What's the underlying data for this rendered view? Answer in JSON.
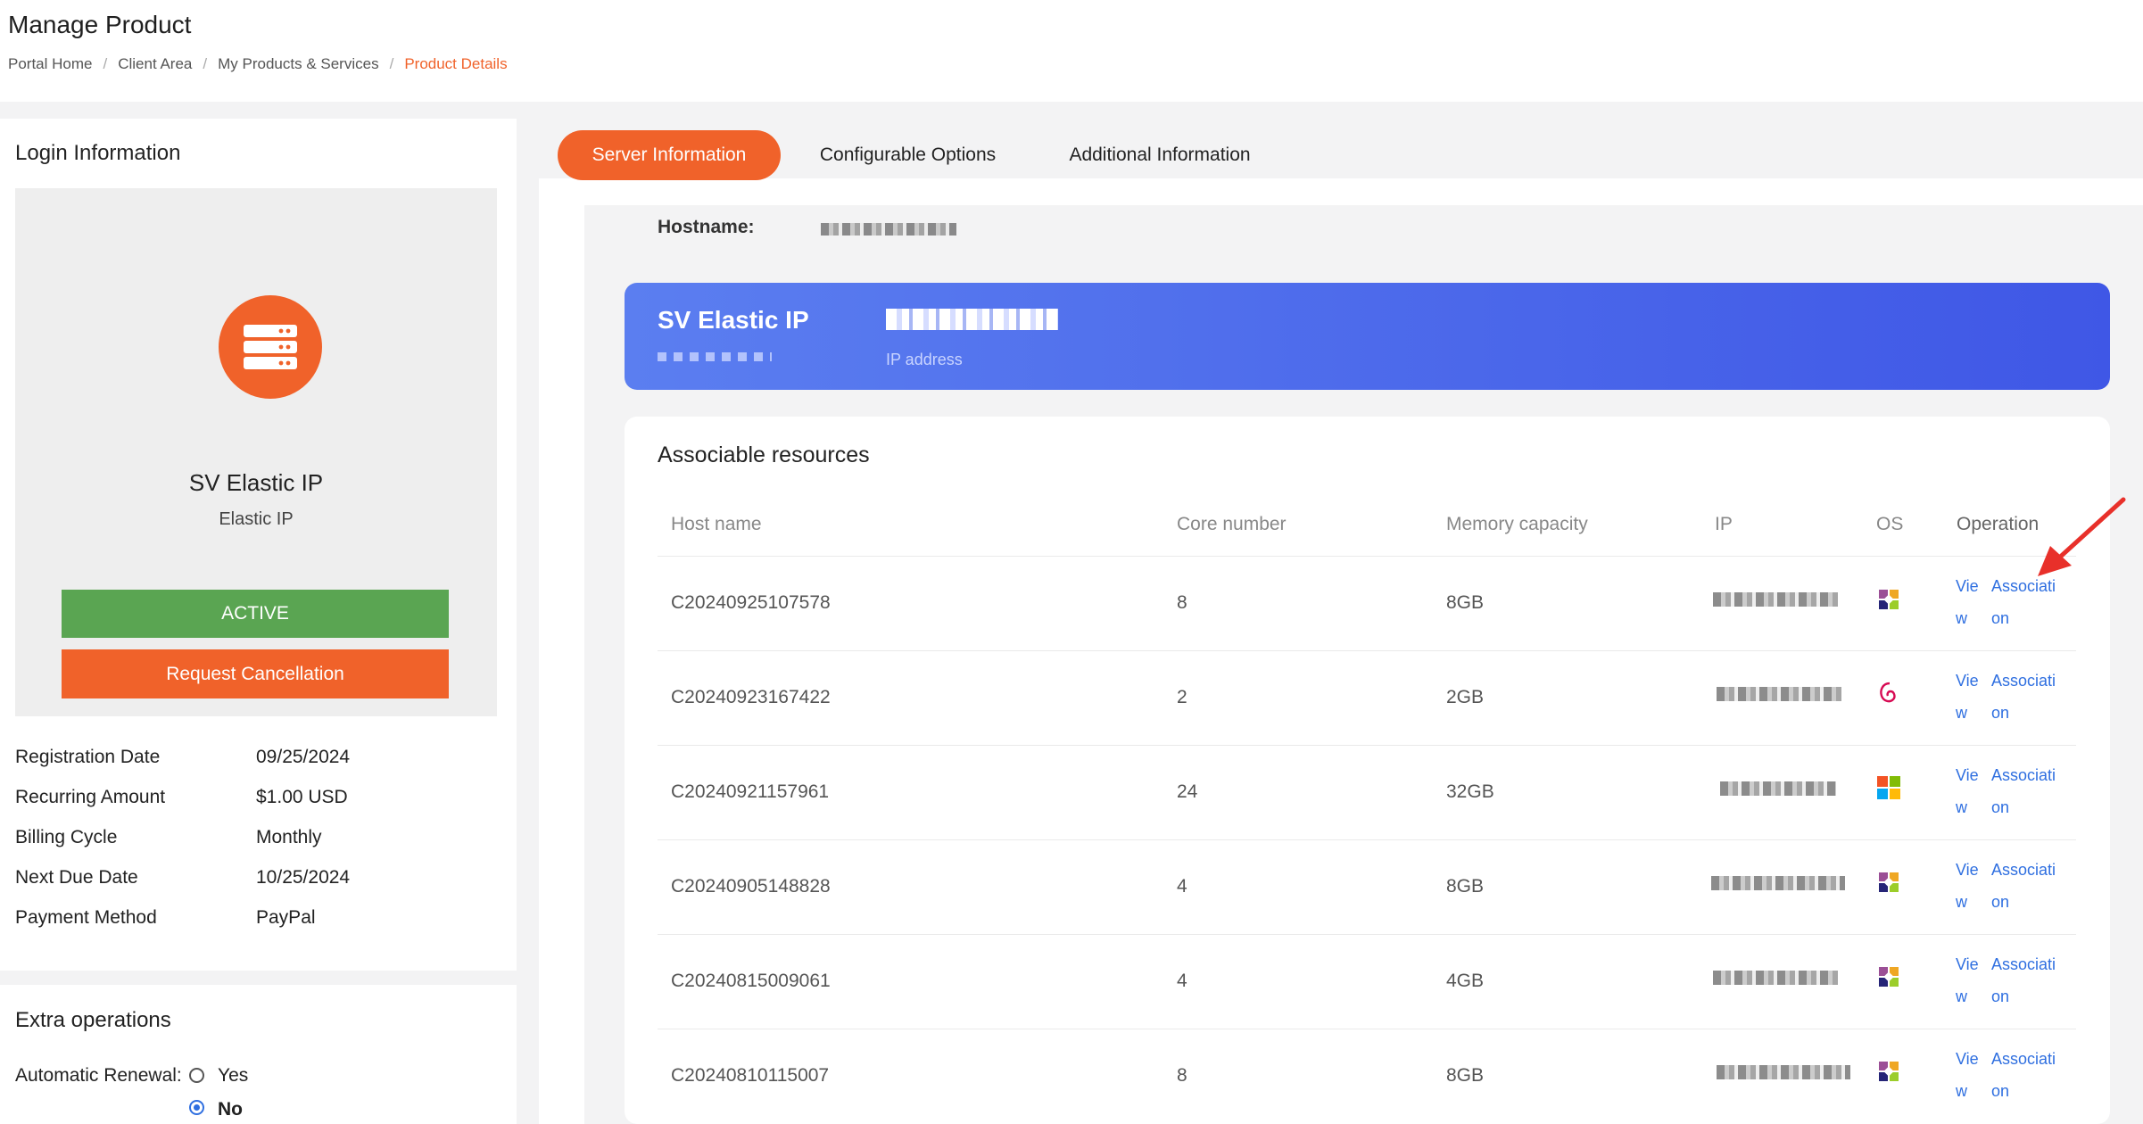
{
  "page": {
    "title": "Manage Product",
    "breadcrumb": [
      "Portal Home",
      "Client Area",
      "My Products & Services",
      "Product Details"
    ]
  },
  "login_info": {
    "title": "Login Information",
    "product_name": "SV Elastic IP",
    "product_type": "Elastic IP",
    "status_label": "ACTIVE",
    "cancel_label": "Request Cancellation",
    "details": [
      {
        "label": "Registration Date",
        "value": "09/25/2024"
      },
      {
        "label": "Recurring Amount",
        "value": "$1.00 USD"
      },
      {
        "label": "Billing Cycle",
        "value": "Monthly"
      },
      {
        "label": "Next Due Date",
        "value": "10/25/2024"
      },
      {
        "label": "Payment Method",
        "value": "PayPal"
      }
    ]
  },
  "extra": {
    "title": "Extra operations",
    "auto_renew_label": "Automatic Renewal:",
    "options": [
      "Yes",
      "No"
    ],
    "selected": "No"
  },
  "tabs": [
    "Server Information",
    "Configurable Options",
    "Additional Information"
  ],
  "active_tab": "Server Information",
  "server": {
    "hostname_label": "Hostname:",
    "banner_title": "SV Elastic IP",
    "banner_sub": "IP address"
  },
  "assoc": {
    "title": "Associable resources",
    "headers": [
      "Host name",
      "Core number",
      "Memory capacity",
      "IP",
      "OS",
      "Operation"
    ],
    "view_label_1": "Vie",
    "view_label_2": "w",
    "assoc_label_1": "Associati",
    "assoc_label_2": "on",
    "rows": [
      {
        "host": "C20240925107578",
        "cores": "8",
        "memory": "8GB",
        "os": "centos-icon"
      },
      {
        "host": "C20240923167422",
        "cores": "2",
        "memory": "2GB",
        "os": "debian-icon"
      },
      {
        "host": "C20240921157961",
        "cores": "24",
        "memory": "32GB",
        "os": "windows-icon"
      },
      {
        "host": "C20240905148828",
        "cores": "4",
        "memory": "8GB",
        "os": "centos-icon"
      },
      {
        "host": "C20240815009061",
        "cores": "4",
        "memory": "4GB",
        "os": "centos-icon"
      },
      {
        "host": "C20240810115007",
        "cores": "8",
        "memory": "8GB",
        "os": "centos-icon"
      }
    ]
  },
  "colors": {
    "accent": "#f0622a",
    "active_green": "#5aa552",
    "link_blue": "#2f6fe0",
    "banner_blue": "#4a66ea"
  }
}
